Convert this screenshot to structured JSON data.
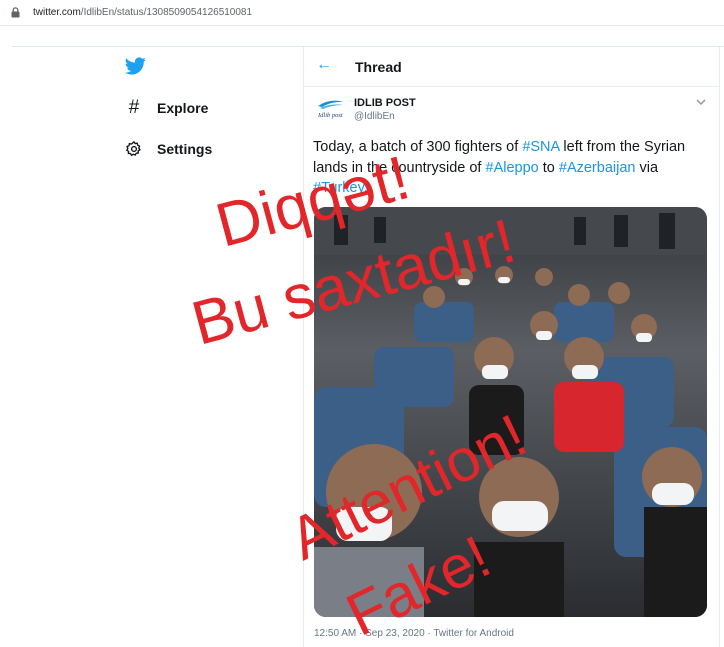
{
  "browser": {
    "url_host": "twitter.com",
    "url_path": "/IdlibEn/status/1308509054126510081"
  },
  "sidebar": {
    "items": [
      {
        "label": "Explore",
        "icon": "hashtag-icon"
      },
      {
        "label": "Settings",
        "icon": "gear-icon"
      }
    ]
  },
  "thread": {
    "title": "Thread"
  },
  "tweet": {
    "author_name": "IDLIB POST",
    "author_handle": "@IdlibEn",
    "avatar_caption": "Idlib post",
    "text": {
      "t1": "Today, a batch of 300 fighters of ",
      "tag1": "#SNA",
      "t2": " left from the Syrian lands in the countryside of ",
      "tag2": "#Aleppo",
      "t3": " to ",
      "tag3": "#Azerbaijan",
      "t4": " via ",
      "tag4": "#Turkey",
      "t5": "."
    },
    "meta": "12:50 AM · Sep 23, 2020 · Twitter for Android"
  },
  "overlay": {
    "line1": "Diqqət!",
    "line2": "Bu saxtadır!",
    "line3": "Attention!",
    "line4": "Fake!"
  },
  "colors": {
    "twitter_blue": "#1da1f2",
    "hashtag": "#1b95e0",
    "overlay_red": "#e2262a"
  }
}
